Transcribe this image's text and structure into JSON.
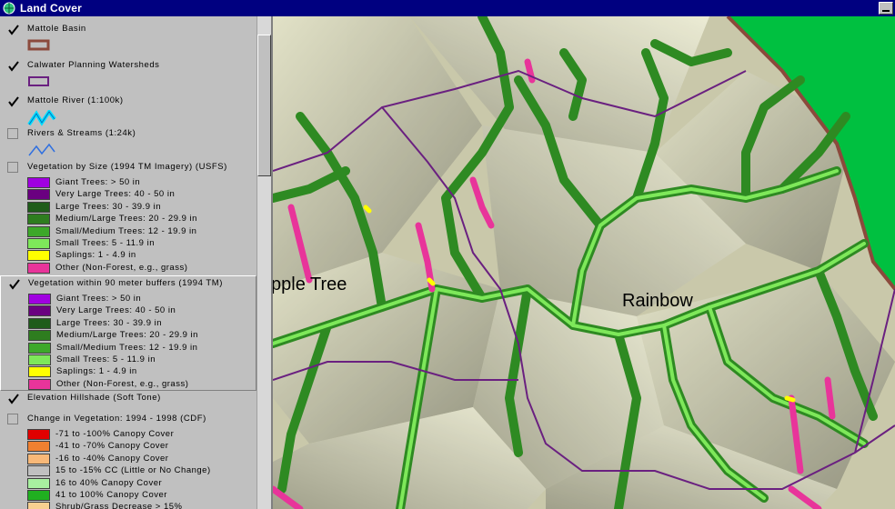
{
  "window": {
    "title": "Land Cover"
  },
  "legend": {
    "themes": [
      {
        "name": "Mattole Basin",
        "checked": true
      },
      {
        "name": "Calwater Planning Watersheds",
        "checked": true
      },
      {
        "name": "Mattole River (1:100k)",
        "checked": true
      },
      {
        "name": "Rivers & Streams (1:24k)",
        "checked": false
      },
      {
        "name": "Vegetation by Size (1994 TM Imagery) (USFS)",
        "checked": false,
        "entries": [
          {
            "label": "Giant Trees: > 50 in",
            "color": "#a000e0"
          },
          {
            "label": "Very Large Trees: 40 - 50 in",
            "color": "#6a0080"
          },
          {
            "label": "Large Trees: 30 - 39.9 in",
            "color": "#1f5c1a"
          },
          {
            "label": "Medium/Large Trees: 20 - 29.9 in",
            "color": "#2e7d1f"
          },
          {
            "label": "Small/Medium Trees: 12 - 19.9 in",
            "color": "#3da82a"
          },
          {
            "label": "Small Trees: 5 - 11.9 in",
            "color": "#7ee85a"
          },
          {
            "label": "Saplings: 1 - 4.9 in",
            "color": "#ffff00"
          },
          {
            "label": "Other (Non-Forest, e.g., grass)",
            "color": "#e8349a"
          }
        ]
      },
      {
        "name": "Vegetation within 90 meter buffers (1994 TM)",
        "checked": true,
        "entries": [
          {
            "label": "Giant Trees: > 50 in",
            "color": "#a000e0"
          },
          {
            "label": "Very Large Trees: 40 - 50 in",
            "color": "#6a0080"
          },
          {
            "label": "Large Trees: 30 - 39.9 in",
            "color": "#1f5c1a"
          },
          {
            "label": "Medium/Large Trees: 20 - 29.9 in",
            "color": "#2e7d1f"
          },
          {
            "label": "Small/Medium Trees: 12 - 19.9 in",
            "color": "#3da82a"
          },
          {
            "label": "Small Trees: 5 - 11.9 in",
            "color": "#7ee85a"
          },
          {
            "label": "Saplings: 1 - 4.9 in",
            "color": "#ffff00"
          },
          {
            "label": "Other (Non-Forest, e.g., grass)",
            "color": "#e8349a"
          }
        ]
      },
      {
        "name": "Elevation Hillshade (Soft Tone)",
        "checked": true
      },
      {
        "name": "Change in Vegetation: 1994 - 1998 (CDF)",
        "checked": false,
        "entries": [
          {
            "label": "-71 to -100% Canopy Cover",
            "color": "#e00000"
          },
          {
            "label": "-41 to -70% Canopy Cover",
            "color": "#f08030"
          },
          {
            "label": "-16 to -40% Canopy Cover",
            "color": "#f8b878"
          },
          {
            "label": "15 to -15% CC (Little or No Change)",
            "color": "#c0c0c0"
          },
          {
            "label": "16 to 40% Canopy Cover",
            "color": "#a8f0a0"
          },
          {
            "label": "41 to 100% Canopy Cover",
            "color": "#20b020"
          },
          {
            "label": "Shrub/Grass Decrease > 15%",
            "color": "#f8d090"
          }
        ]
      }
    ]
  },
  "map": {
    "place_labels": [
      "pple Tree",
      "Rainbow"
    ],
    "colors": {
      "hillshade": "#c9c8aa",
      "basin_boundary": "#8b4a3c",
      "watershed_boundary": "#6a2080",
      "outside_basin": "#00c040"
    }
  },
  "icons": {
    "app": "globe-icon",
    "check": "checkmark-icon"
  }
}
